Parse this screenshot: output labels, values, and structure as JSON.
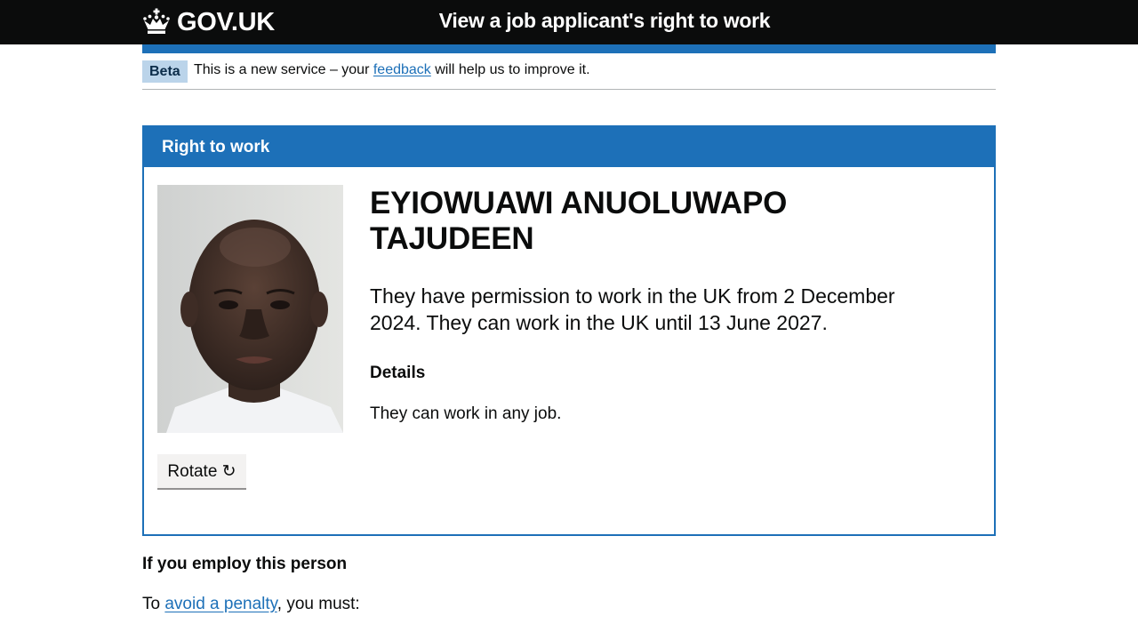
{
  "header": {
    "logo_text": "GOV.UK",
    "service_name": "View a job applicant's right to work"
  },
  "phase_banner": {
    "tag": "Beta",
    "text_before": "This is a new service – your ",
    "link_text": "feedback",
    "text_after": " will help us to improve it."
  },
  "card": {
    "title": "Right to work",
    "name": "EYIOWUAWI ANUOLUWAPO TAJUDEEN",
    "permission": "They have permission to work in the UK from 2 December 2024. They can work in the UK until 13 June 2027.",
    "details_heading": "Details",
    "details_text": "They can work in any job.",
    "rotate_label": "Rotate ↻"
  },
  "employ": {
    "heading": "If you employ this person",
    "text_before": "To ",
    "link_text": "avoid a penalty",
    "text_after": ", you must:"
  },
  "colors": {
    "header_bg": "#0b0c0c",
    "brand_blue": "#1d70b8",
    "phase_tag_bg": "#bbd4ea",
    "button_bg": "#f3f2f1"
  },
  "icons": {
    "logo": "crown-icon",
    "rotate": "rotate-arrow-icon"
  }
}
